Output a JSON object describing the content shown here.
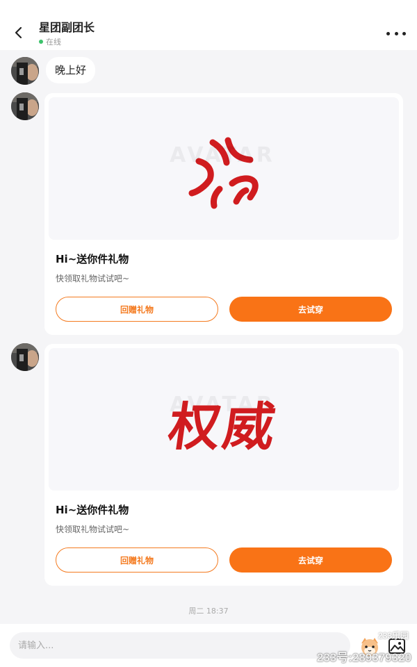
{
  "header": {
    "title": "星团副团长",
    "status": "在线",
    "status_color": "#3cc26b"
  },
  "icons": {
    "back": "chevron-left-icon",
    "more": "more-dots-icon",
    "emoji": "emoji-icon",
    "image": "image-icon"
  },
  "messages": [
    {
      "type": "text",
      "text": "晚上好"
    },
    {
      "type": "gift_card",
      "sticker": "anger-symbol",
      "title": "Hi~送你件礼物",
      "subtitle": "快领取礼物试试吧~",
      "return_label": "回赠礼物",
      "try_label": "去试穿"
    },
    {
      "type": "gift_card",
      "sticker_text": "权威",
      "title": "Hi~送你件礼物",
      "subtitle": "快领取礼物试试吧~",
      "return_label": "回赠礼物",
      "try_label": "去试穿"
    }
  ],
  "timestamp": "周二 18:37",
  "input": {
    "placeholder": "请输入...",
    "value": ""
  },
  "watermark": {
    "logo": "233乐园",
    "id_text": "233号:289379320"
  },
  "colors": {
    "accent": "#f97316",
    "sticker_red": "#d01c1f",
    "background": "#f5f5f7"
  }
}
